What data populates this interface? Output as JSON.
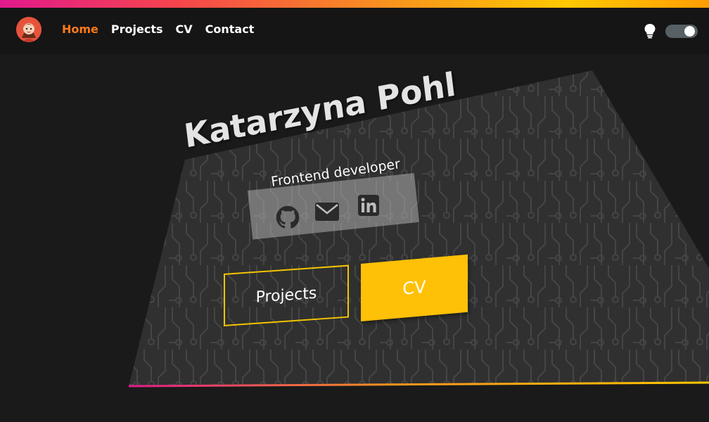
{
  "nav": {
    "links": [
      {
        "label": "Home",
        "active": true
      },
      {
        "label": "Projects",
        "active": false
      },
      {
        "label": "CV",
        "active": false
      },
      {
        "label": "Contact",
        "active": false
      }
    ]
  },
  "hero": {
    "name": "Katarzyna Pohl",
    "subtitle": "Frontend developer",
    "social": [
      "github-icon",
      "mail-icon",
      "linkedin-icon"
    ],
    "buttons": {
      "projects": "Projects",
      "cv": "CV"
    }
  },
  "colors": {
    "accent_orange": "#ff7a1a",
    "accent_yellow": "#ffc107",
    "background": "#1a1a1a",
    "card": "#303030"
  },
  "theme_toggle": {
    "on": true
  }
}
